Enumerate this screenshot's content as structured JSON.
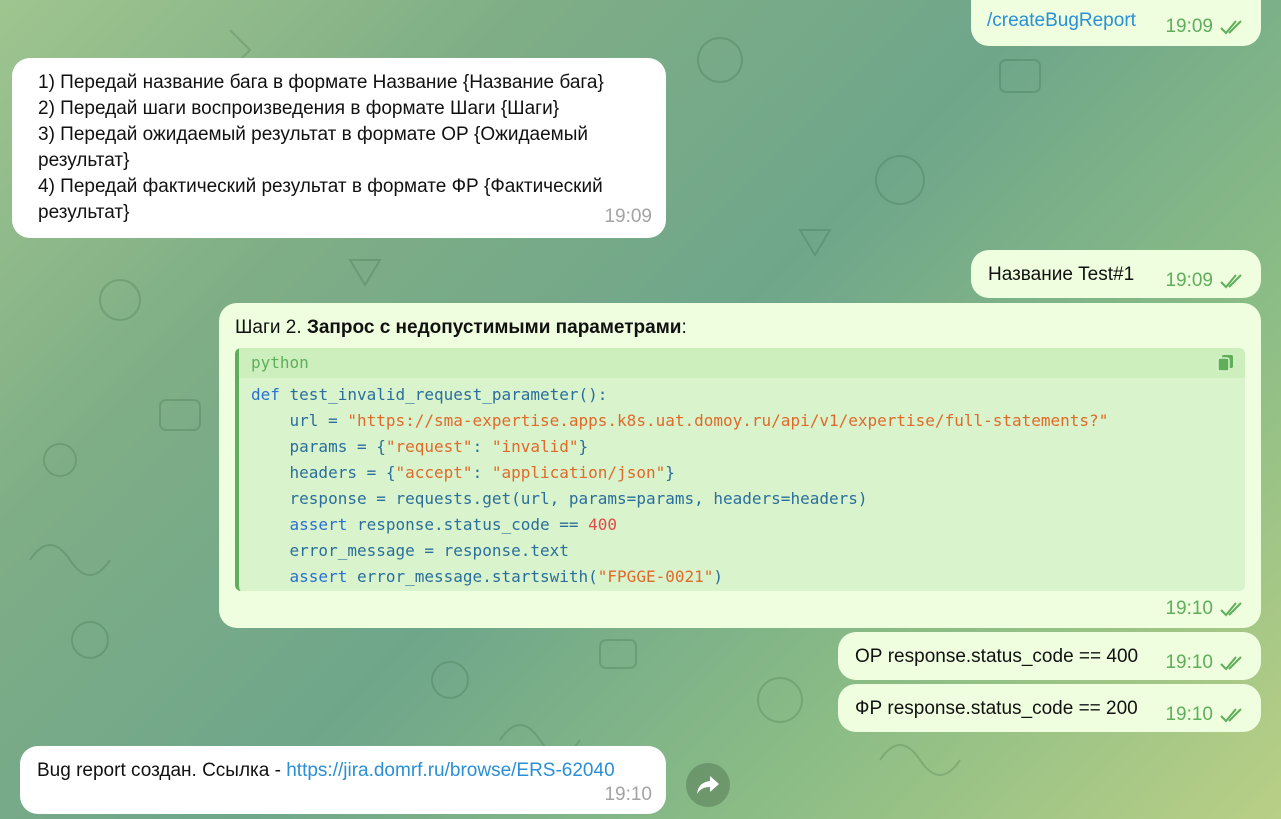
{
  "messages": {
    "cmd": {
      "text": "/createBugReport",
      "time": "19:09"
    },
    "instructions": {
      "lines": [
        "1) Передай название бага в формате Название {Название бага}",
        "2) Передай шаги воспроизведения в формате Шаги {Шаги}",
        "3) Передай ожидаемый результат в формате ОР {Ожидаемый",
        "результат}",
        "4) Передай фактический результат в формате ФР {Фактический",
        "результат}"
      ],
      "time": "19:09"
    },
    "name": {
      "text": "Название Test#1",
      "time": "19:09"
    },
    "steps": {
      "prefix": "Шаги 2. ",
      "bold": "Запрос с недопустимыми параметрами",
      "suffix": ":",
      "code_lang": "python",
      "code_lines": [
        "def test_invalid_request_parameter():",
        "    url = \"https://sma-expertise.apps.k8s.uat.domoy.ru/api/v1/expertise/full-statements?\"",
        "    params = {\"request\": \"invalid\"}",
        "    headers = {\"accept\": \"application/json\"}",
        "    response = requests.get(url, params=params, headers=headers)",
        "    assert response.status_code == 400",
        "    error_message = response.text",
        "    assert error_message.startswith(\"FPGGE-0021\")"
      ],
      "time": "19:10"
    },
    "expected": {
      "text": "ОР response.status_code == 400",
      "time": "19:10"
    },
    "actual": {
      "text": "ФР response.status_code == 200",
      "time": "19:10"
    },
    "created": {
      "text": "Bug report создан. Ссылка - ",
      "link": "https://jira.domrf.ru/browse/ERS-62040",
      "time": "19:10"
    }
  },
  "icons": {
    "read": "double-check-icon",
    "copy": "copy-icon",
    "forward": "forward-arrow-icon"
  },
  "colors": {
    "outgoing_bubble": "#eefedf",
    "incoming_bubble": "#ffffff",
    "accent": "#5fae5a",
    "link": "#2a8fd4"
  }
}
